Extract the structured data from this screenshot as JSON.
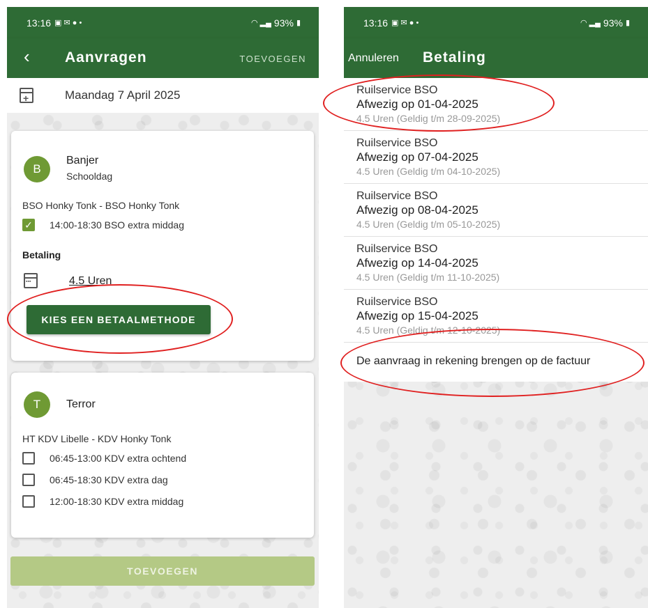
{
  "left": {
    "status": {
      "time": "13:16",
      "battery": "93%"
    },
    "appbar": {
      "title": "Aanvragen",
      "action": "TOEVOEGEN"
    },
    "date": "Maandag 7 April 2025",
    "cards": [
      {
        "initial": "B",
        "name": "Banjer",
        "sub": "Schooldag",
        "location": "BSO Honky Tonk - BSO Honky Tonk",
        "options": [
          {
            "label": "14:00-18:30 BSO extra middag",
            "checked": true
          }
        ],
        "payment_label": "Betaling",
        "hours": "4.5 Uren",
        "button": "KIES EEN BETAALMETHODE"
      },
      {
        "initial": "T",
        "name": "Terror",
        "location": "HT KDV Libelle - KDV Honky Tonk",
        "options": [
          {
            "label": "06:45-13:00 KDV extra ochtend",
            "checked": false
          },
          {
            "label": "06:45-18:30 KDV extra dag",
            "checked": false
          },
          {
            "label": "12:00-18:30 KDV extra middag",
            "checked": false
          }
        ]
      }
    ],
    "add_button": "TOEVOEGEN"
  },
  "right": {
    "status": {
      "time": "13:16",
      "battery": "93%"
    },
    "appbar": {
      "cancel": "Annuleren",
      "title": "Betaling"
    },
    "items": [
      {
        "service": "Ruilservice BSO",
        "absent": "Afwezig op 01-04-2025",
        "detail": "4.5 Uren (Geldig t/m 28-09-2025)"
      },
      {
        "service": "Ruilservice BSO",
        "absent": "Afwezig op 07-04-2025",
        "detail": "4.5 Uren (Geldig t/m 04-10-2025)"
      },
      {
        "service": "Ruilservice BSO",
        "absent": "Afwezig op 08-04-2025",
        "detail": "4.5 Uren (Geldig t/m 05-10-2025)"
      },
      {
        "service": "Ruilservice BSO",
        "absent": "Afwezig op 14-04-2025",
        "detail": "4.5 Uren (Geldig t/m 11-10-2025)"
      },
      {
        "service": "Ruilservice BSO",
        "absent": "Afwezig op 15-04-2025",
        "detail": "4.5 Uren (Geldig t/m 12-10-2025)"
      }
    ],
    "invoice": "De aanvraag in rekening brengen op de factuur"
  },
  "colors": {
    "primary": "#2e6b35",
    "avatar": "#6f9a34",
    "annotation": "#e02020",
    "disabled_button": "#b4c985"
  }
}
